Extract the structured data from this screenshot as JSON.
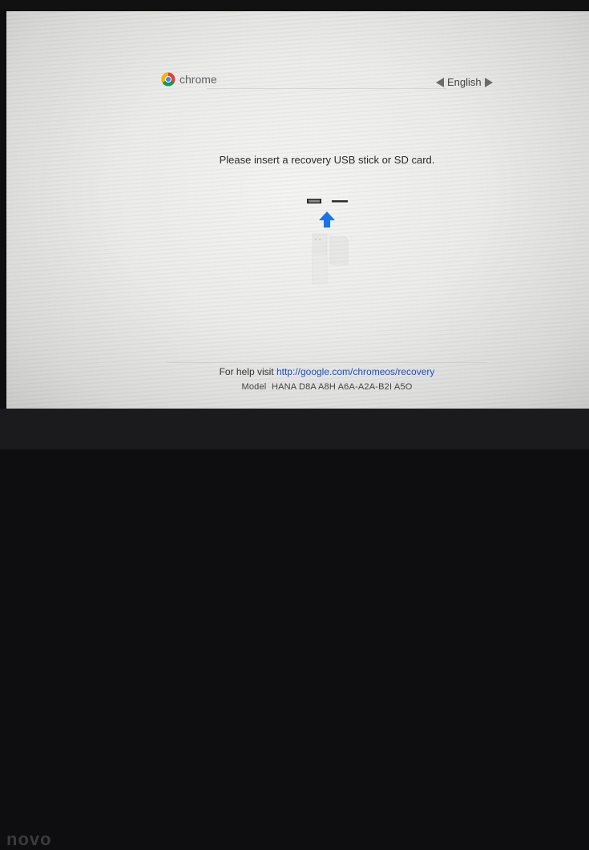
{
  "header": {
    "logo_text": "chrome",
    "language": "English"
  },
  "main": {
    "instruction": "Please insert a recovery USB stick or SD card."
  },
  "footer": {
    "help_prefix": "For help visit",
    "help_link": "http://google.com/chromeos/recovery",
    "model_label": "Model",
    "model_value": "HANA D8A A8H A6A-A2A-B2I A5O"
  },
  "device": {
    "bezel_brand": "novo"
  },
  "icons": {
    "logo": "chrome-logo-icon",
    "prev_language": "triangle-left-icon",
    "next_language": "triangle-right-icon",
    "usb": "usb-slot-icon",
    "sd": "sd-slot-icon",
    "insert_arrow": "arrow-up-icon"
  },
  "colors": {
    "accent_blue": "#1a73e8",
    "link_blue": "#1a4fc4"
  }
}
